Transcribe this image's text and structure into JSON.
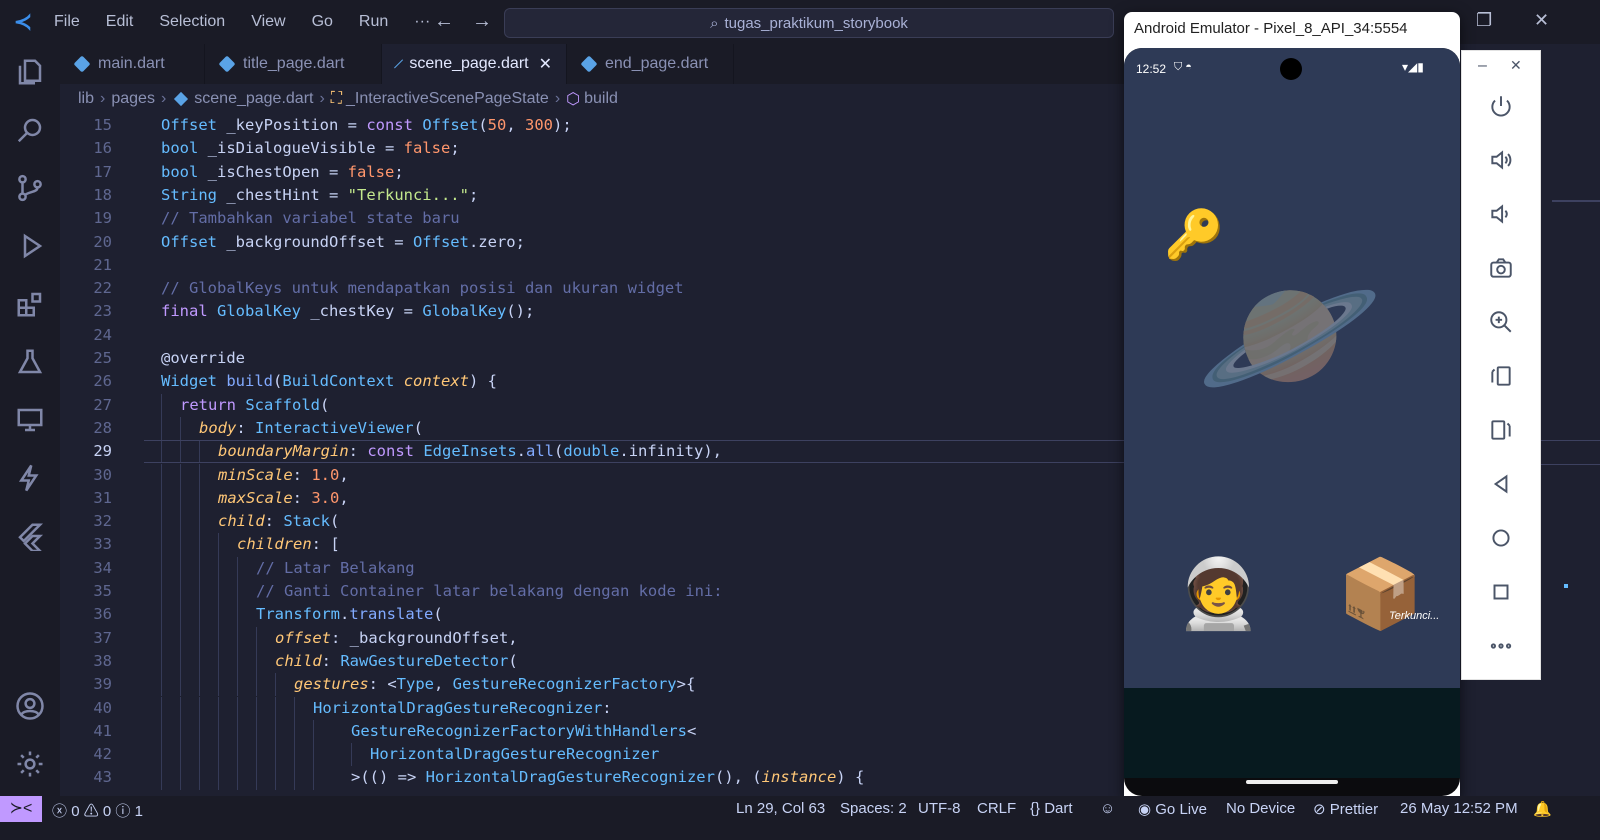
{
  "menu": [
    "File",
    "Edit",
    "Selection",
    "View",
    "Go",
    "Run"
  ],
  "menu_more": "···",
  "search": {
    "text": "tugas_praktikum_storybook"
  },
  "tabs": [
    {
      "label": "main.dart"
    },
    {
      "label": "title_page.dart"
    },
    {
      "label": "scene_page.dart"
    },
    {
      "label": "end_page.dart"
    }
  ],
  "breadcrumbs": [
    "lib",
    "pages",
    "scene_page.dart",
    "_InteractiveScenePageState",
    "build"
  ],
  "editor": {
    "current_line": "29",
    "line_numbers": [
      "15",
      "16",
      "17",
      "18",
      "19",
      "20",
      "21",
      "22",
      "23",
      "24",
      "25",
      "26",
      "27",
      "28",
      "29",
      "30",
      "31",
      "32",
      "33",
      "34",
      "35",
      "36",
      "37",
      "38",
      "39",
      "40",
      "41",
      "42",
      "43"
    ]
  },
  "emulator": {
    "title": "Android Emulator - Pixel_8_API_34:5554",
    "time": "12:52",
    "chest_hint": "Terkunci...",
    "emojis": {
      "key": "🔑",
      "planet": "🪐",
      "astronaut": "🧑‍🚀",
      "chest": "📦"
    }
  },
  "status": {
    "errors": "0",
    "warnings": "0",
    "info": "1",
    "position": "Ln 29, Col 63",
    "spaces": "Spaces: 2",
    "encoding": "UTF-8",
    "eol": "CRLF",
    "language": "Dart",
    "go_live": "Go Live",
    "device": "No Device",
    "prettier": "Prettier",
    "datetime": "26 May 12:52 PM"
  },
  "colors": {
    "accent": "#c099ff",
    "editor_bg": "#1e2030",
    "sidebar_bg": "#1a1b26",
    "scene_bg": "#2e3a56"
  }
}
